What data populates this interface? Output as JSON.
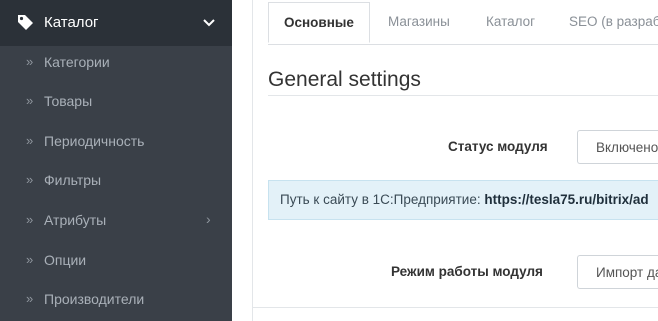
{
  "sidebar": {
    "header": {
      "title": "Каталог",
      "icon": "tag-icon"
    },
    "items": [
      {
        "label": "Категории",
        "has_arrow": false
      },
      {
        "label": "Товары",
        "has_arrow": false
      },
      {
        "label": "Периодичность",
        "has_arrow": false
      },
      {
        "label": "Фильтры",
        "has_arrow": false
      },
      {
        "label": "Атрибуты",
        "has_arrow": true
      },
      {
        "label": "Опции",
        "has_arrow": false
      },
      {
        "label": "Производители",
        "has_arrow": false
      }
    ],
    "bullet": "»",
    "arrow": "›"
  },
  "tabs": [
    {
      "label": "Основные",
      "active": true
    },
    {
      "label": "Магазины",
      "active": false
    },
    {
      "label": "Каталог",
      "active": false
    },
    {
      "label": "SEO (в разрабо",
      "active": false
    }
  ],
  "main": {
    "section_title": "General settings",
    "module_status": {
      "label": "Статус модуля",
      "value": "Включено"
    },
    "info": {
      "prefix": "Путь к сайту в 1С:Предприятие: ",
      "url": "https://tesla75.ru/bitrix/ad"
    },
    "module_mode": {
      "label": "Режим работы модуля",
      "value": "Импорт да"
    }
  },
  "colors": {
    "sidebar_bg": "#3a4048",
    "sidebar_header_bg": "#2b3138",
    "info_bg": "#e3f1f8"
  }
}
